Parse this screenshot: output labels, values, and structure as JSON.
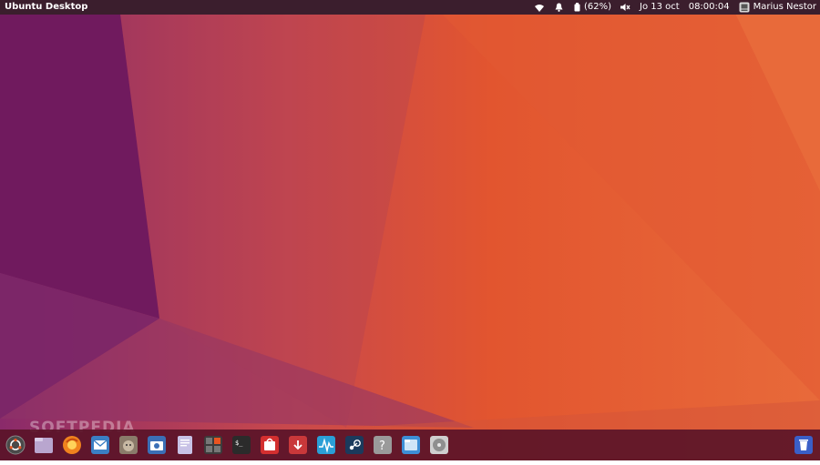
{
  "panel": {
    "app_title": "Ubuntu Desktop",
    "battery_percent": "(62%)",
    "date": "Jo 13 oct",
    "time": "08:00:04",
    "user_name": "Marius Nestor"
  },
  "watermark": "SOFTPEDIA",
  "launcher": {
    "items": [
      {
        "name": "ubuntu-home-icon",
        "color": "#3a3a3a"
      },
      {
        "name": "files-icon",
        "color": "#b9a6cf"
      },
      {
        "name": "firefox-icon",
        "color": "#f0821e"
      },
      {
        "name": "thunderbird-mail-icon",
        "color": "#3b7fc4"
      },
      {
        "name": "gimp-icon",
        "color": "#8a7b6a"
      },
      {
        "name": "camera-icon",
        "color": "#3b6fb6"
      },
      {
        "name": "text-editor-icon",
        "color": "#c8c2e6"
      },
      {
        "name": "calculator-icon",
        "color": "#3c3c3c"
      },
      {
        "name": "terminal-icon",
        "color": "#2b2b2b"
      },
      {
        "name": "software-center-icon",
        "color": "#d32f2f"
      },
      {
        "name": "software-updater-icon",
        "color": "#c9383a"
      },
      {
        "name": "system-monitor-icon",
        "color": "#2a9fd6"
      },
      {
        "name": "steam-icon",
        "color": "#1b3a5c"
      },
      {
        "name": "help-icon",
        "color": "#9a9a9a"
      },
      {
        "name": "file-manager-icon",
        "color": "#3d8fd6"
      },
      {
        "name": "disk-icon",
        "color": "#8f8f8f"
      }
    ],
    "trash": {
      "name": "trash-icon",
      "color": "#3a5fc8"
    }
  }
}
